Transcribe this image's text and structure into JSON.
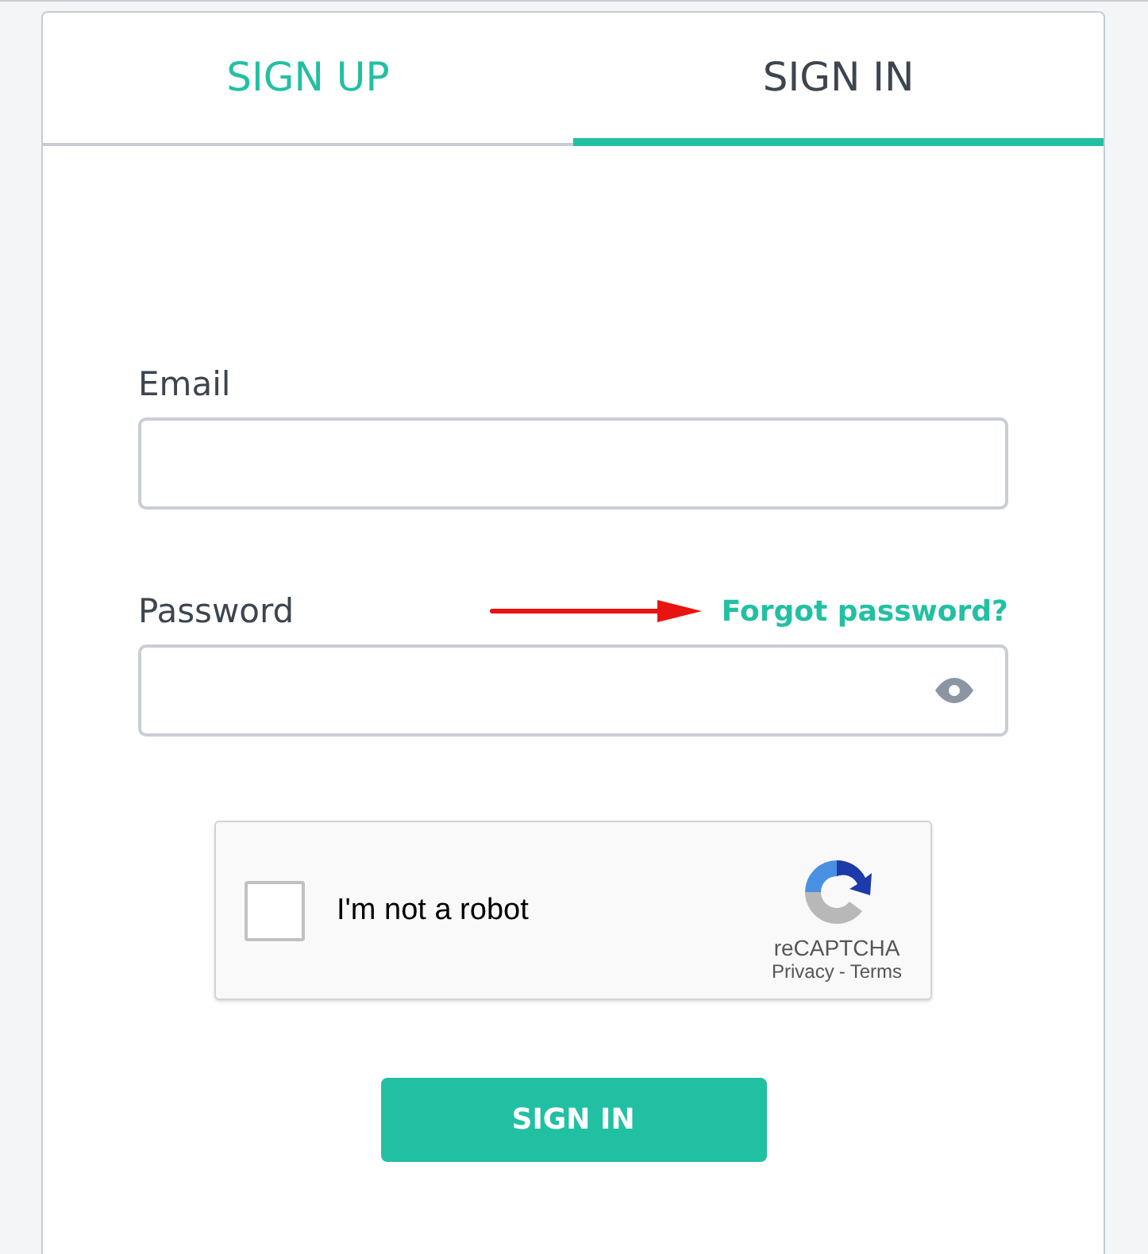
{
  "tabs": [
    {
      "label": "SIGN UP",
      "selected": false
    },
    {
      "label": "SIGN IN",
      "selected": true
    }
  ],
  "form": {
    "email": {
      "label": "Email"
    },
    "password": {
      "label": "Password",
      "forgot_link": "Forgot password?"
    },
    "annotation": {
      "kind": "arrow"
    },
    "captcha": {
      "label": "I'm not a robot",
      "checked": false,
      "brand": "reCAPTCHA",
      "privacy_link": "Privacy",
      "separator": "-",
      "terms_link": "Terms"
    },
    "submit": "SIGN IN"
  }
}
